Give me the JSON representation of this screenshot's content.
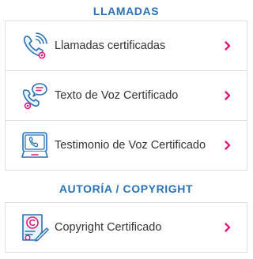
{
  "sections": [
    {
      "title": "LLAMADAS",
      "items": [
        {
          "label": "Llamadas certificadas",
          "icon": "phone-waves-icon"
        },
        {
          "label": "Texto de Voz Certificado",
          "icon": "phone-chat-icon"
        },
        {
          "label": "Testimonio de Voz Certificado",
          "icon": "phone-screen-icon"
        }
      ]
    },
    {
      "title": "AUTORÍA / COPYRIGHT",
      "items": [
        {
          "label": "Copyright Certificado",
          "icon": "copyright-certificate-icon"
        }
      ]
    }
  ],
  "colors": {
    "section_title": "#2a72b5",
    "chevron": "#e0187b",
    "icon_line": "#2a72b5",
    "icon_accent": "#e0187b",
    "label": "#333333",
    "card_border": "#e0e0e0"
  }
}
